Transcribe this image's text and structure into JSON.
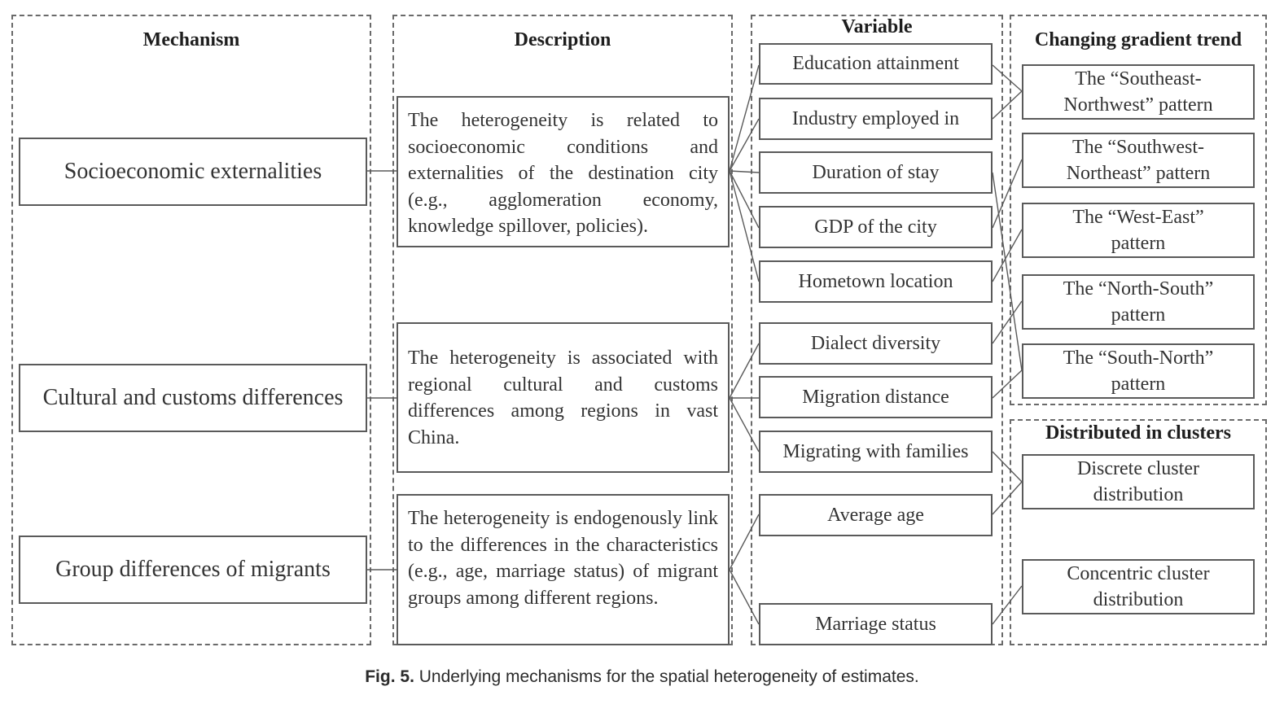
{
  "figure": {
    "caption_label": "Fig. 5.",
    "caption_text": "Underlying mechanisms for the spatial heterogeneity of estimates."
  },
  "columns": {
    "mechanism": {
      "title": "Mechanism",
      "items": [
        "Socioeconomic externalities",
        "Cultural and customs differences",
        "Group differences of migrants"
      ]
    },
    "description": {
      "title": "Description",
      "items": [
        "The heterogeneity is related to socioeconomic conditions and externalities of the destination city (e.g., agglomeration economy, knowledge spillover, policies).",
        "The heterogeneity is associated with regional cultural and customs differences among regions in vast China.",
        "The heterogeneity is endogenously link to the differences in the characteristics (e.g., age, marriage status) of migrant groups among different regions."
      ]
    },
    "variable": {
      "title": "Variable",
      "items": [
        "Education attainment",
        "Industry employed in",
        "Duration of stay",
        "GDP of the city",
        "Hometown location",
        "Dialect diversity",
        "Migration distance",
        "Migrating with families",
        "Average age",
        "Marriage status"
      ]
    },
    "gradient": {
      "title": "Changing gradient trend",
      "items": [
        [
          "The “Southeast-",
          "Northwest” pattern"
        ],
        [
          "The “Southwest-",
          "Northeast” pattern"
        ],
        [
          "The “West-East”",
          "pattern"
        ],
        [
          "The “North-South”",
          "pattern"
        ],
        [
          "The “South-North”",
          "pattern"
        ]
      ]
    },
    "clusters": {
      "title": "Distributed in clusters",
      "items": [
        [
          "Discrete cluster",
          "distribution"
        ],
        [
          "Concentric cluster",
          "distribution"
        ]
      ]
    }
  },
  "links": {
    "mechanism_to_description": [
      [
        0,
        0
      ],
      [
        1,
        1
      ],
      [
        2,
        2
      ]
    ],
    "description_to_variable": [
      [
        0,
        0
      ],
      [
        0,
        1
      ],
      [
        0,
        2
      ],
      [
        0,
        3
      ],
      [
        0,
        4
      ],
      [
        1,
        5
      ],
      [
        1,
        6
      ],
      [
        1,
        7
      ],
      [
        2,
        8
      ],
      [
        2,
        9
      ]
    ],
    "variable_to_pattern": [
      [
        0,
        "gradient",
        0
      ],
      [
        1,
        "gradient",
        0
      ],
      [
        2,
        "gradient",
        4
      ],
      [
        3,
        "gradient",
        1
      ],
      [
        4,
        "gradient",
        2
      ],
      [
        5,
        "gradient",
        3
      ],
      [
        6,
        "gradient",
        4
      ],
      [
        7,
        "clusters",
        0
      ],
      [
        8,
        "clusters",
        0
      ],
      [
        9,
        "clusters",
        1
      ]
    ]
  }
}
